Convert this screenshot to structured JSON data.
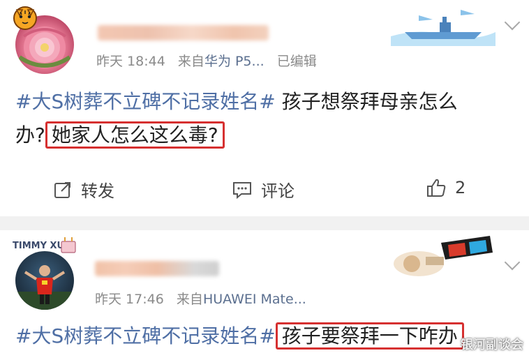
{
  "post1": {
    "timestamp": "昨天 18:44",
    "source_prefix": "来自",
    "source": "华为 P5...",
    "edited": "已编辑",
    "content": {
      "topic": "#大S树葬不立碑不记录姓名#",
      "text_line1": " 孩子想祭拜母亲怎么",
      "text_line2_plain": "办?",
      "text_line2_highlight": "她家人怎么这么毒?"
    },
    "actions": {
      "repost_label": "转发",
      "comment_label": "评论",
      "like_count": "2"
    }
  },
  "post2": {
    "avatar_badge_text": "TIMMY XU",
    "timestamp": "昨天 17:46",
    "source_prefix": "来自",
    "source": "HUAWEI Mate...",
    "content": {
      "topic": "#大S树葬不立碑不记录姓名#",
      "text_highlight": "孩子要祭拜一下咋办"
    }
  },
  "watermark": "银河副谈会",
  "colors": {
    "topic": "#4f6fa5",
    "highlight_border": "#d63030",
    "meta": "#8a8a8a",
    "divider": "#f1f1f1"
  }
}
